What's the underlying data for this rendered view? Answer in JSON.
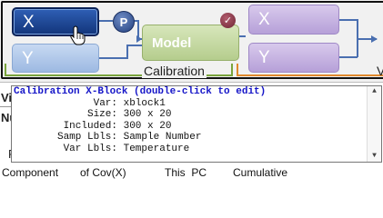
{
  "flow": {
    "calibration": {
      "x_label": "X",
      "y_label": "Y",
      "model_label": "Model",
      "group_label": "Calibration"
    },
    "validation": {
      "x_label": "X",
      "y_label": "Y",
      "group_label_partial": "V"
    },
    "badges": {
      "preprocess_letter": "P"
    },
    "colors": {
      "x_block_selected": "#12357a",
      "y_block": "#9db9e2",
      "model_block": "#b5cd8d",
      "validation_block": "#b6a0d8",
      "calibration_bracket": "#7aa43d",
      "validation_bracket": "#e0892c"
    }
  },
  "tooltip": {
    "title": "Calibration X-Block (double-click to edit)",
    "rows": [
      {
        "key": "Var:",
        "value": "xblock1"
      },
      {
        "key": "Size:",
        "value": "300 x 20"
      },
      {
        "key": "Included:",
        "value": "300 x 20"
      },
      {
        "key": "Samp Lbls:",
        "value": "Sample Number"
      },
      {
        "key": "Var Lbls:",
        "value": "Temperature"
      }
    ]
  },
  "background_table": {
    "left_fragments": [
      "Vi",
      "Nu",
      "P"
    ],
    "headers": [
      "Component",
      "of Cov(X)",
      "This  PC",
      "Cumulative"
    ]
  }
}
